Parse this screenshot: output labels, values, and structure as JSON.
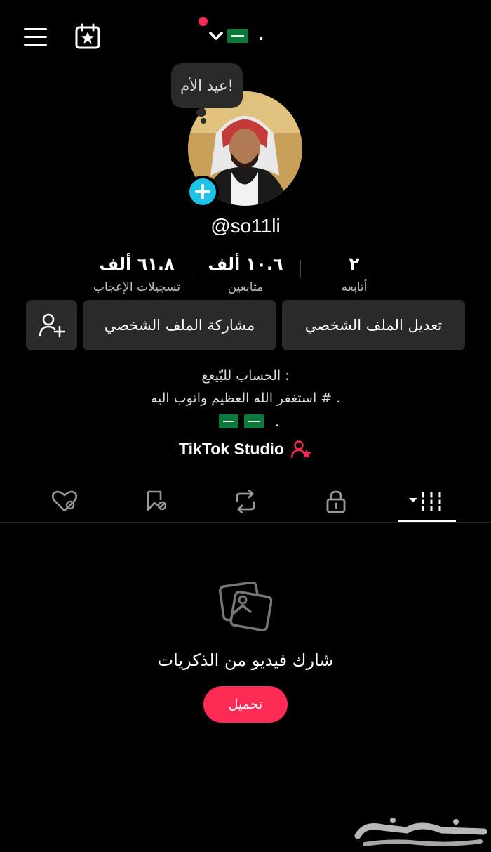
{
  "header": {
    "flag_icon": "saudi-flag-icon",
    "dot_text": "."
  },
  "profile": {
    "bubble_text": "عيد الأم!",
    "username": "@so11li"
  },
  "stats": [
    {
      "value": "٢",
      "label": "أتابعه"
    },
    {
      "value": "١٠.٦ ألف",
      "label": "متابعين"
    },
    {
      "value": "٦١.٨ ألف",
      "label": "تسجيلات الإعجاب"
    }
  ],
  "actions": {
    "edit_profile": "تعديل الملف الشخصي",
    "share_profile": "مشاركة الملف الشخصي"
  },
  "bio": {
    "line1": "الحساب للبّيعع :",
    "line2": "استغفر الله العظيم واتوب اليه # .",
    "line3": "."
  },
  "studio": {
    "label": "TikTok Studio"
  },
  "empty_state": {
    "message": "شارك فيديو من الذكريات",
    "upload_label": "تحميل"
  },
  "watermark": {
    "text": "حراج"
  },
  "colors": {
    "accent": "#fe2c55",
    "badge": "#20c3e8",
    "button_bg": "#2a2a2a"
  }
}
